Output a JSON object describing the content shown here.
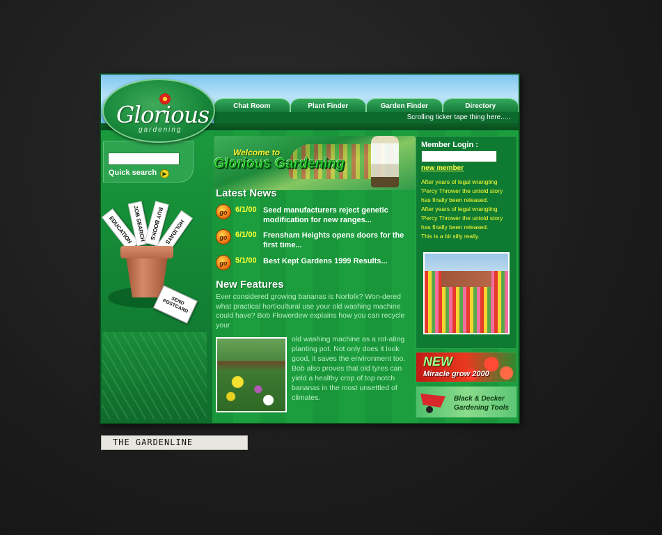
{
  "logo": {
    "title": "Glorious",
    "subtitle": "gardening"
  },
  "nav": {
    "items": [
      "Chat Room",
      "Plant Finder",
      "Garden Finder",
      "Directory"
    ]
  },
  "ticker": {
    "text": "Scrolling ticker tape thing here....."
  },
  "search": {
    "value": "",
    "button_label": "Quick search"
  },
  "signs": [
    "EDUCATION",
    "JOB SEARCH",
    "BUY BOOKS",
    "HOLIDAYS"
  ],
  "postcard": {
    "label": "SEND POSTCARD"
  },
  "welcome": {
    "line1": "Welcome to",
    "line2": "Glorious Gardening"
  },
  "latest_news": {
    "heading": "Latest News",
    "items": [
      {
        "date": "6/1/00",
        "text": "Seed manufacturers reject genetic modification for new ranges..."
      },
      {
        "date": "6/1/00",
        "text": "Frensham Heights opens doors for the first time..."
      },
      {
        "date": "5/1/00",
        "text": "Best Kept Gardens 1999 Results..."
      }
    ]
  },
  "new_features": {
    "heading": "New Features",
    "intro": "Ever considered growing bananas is Norfolk? Won-dered what practical horticultural use your  old washing machine could have? Bob  Flowerdew explains how you can  recycle your",
    "continued": "old washing machine as a rot-ating planting pot. Not only does it look good, it  saves the environment too.  Bob also proves that old tyres can yield a healthy crop of top notch bananas in the most unsettled of climates."
  },
  "member": {
    "heading": "Member Login :",
    "new_member": "new member",
    "messages": [
      "After years of legal wrangling",
      "'Percy Thrower the untold story",
      "has finally been  released.",
      "After years of legal wrangling",
      "'Percy Thrower the untold story",
      "has finally been  released.",
      "This is a bit silly really."
    ]
  },
  "promos": {
    "new_title": "NEW",
    "new_subtitle": "Miracle grow 2000",
    "bd_text": "Black & Decker Gardening Tools"
  },
  "caption": "THE GARDENLINE"
}
